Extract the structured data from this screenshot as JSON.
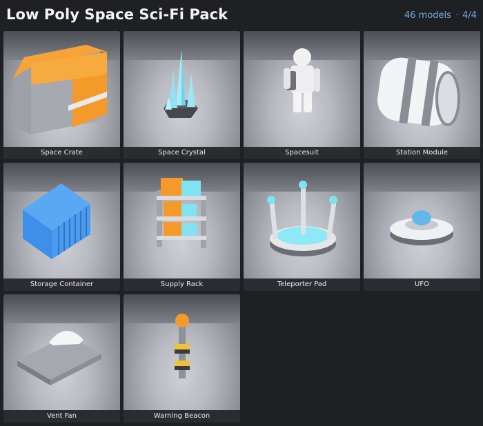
{
  "header": {
    "title": "Low Poly Space Sci-Fi Pack",
    "model_count": "46 models",
    "page": "4/4"
  },
  "models": [
    {
      "name": "Space Crate",
      "icon": "space-crate"
    },
    {
      "name": "Space Crystal",
      "icon": "space-crystal"
    },
    {
      "name": "Spacesuit",
      "icon": "spacesuit"
    },
    {
      "name": "Station Module",
      "icon": "station-module"
    },
    {
      "name": "Storage Container",
      "icon": "storage-container"
    },
    {
      "name": "Supply Rack",
      "icon": "supply-rack"
    },
    {
      "name": "Teleporter Pad",
      "icon": "teleporter-pad"
    },
    {
      "name": "UFO",
      "icon": "ufo"
    },
    {
      "name": "Vent Fan",
      "icon": "vent-fan"
    },
    {
      "name": "Warning Beacon",
      "icon": "warning-beacon"
    }
  ],
  "colors": {
    "background": "#1f2024",
    "accent_text": "#79a9d8",
    "orange": "#f59a2a",
    "cyan": "#7fe3f2",
    "blue": "#3d8fe8"
  }
}
